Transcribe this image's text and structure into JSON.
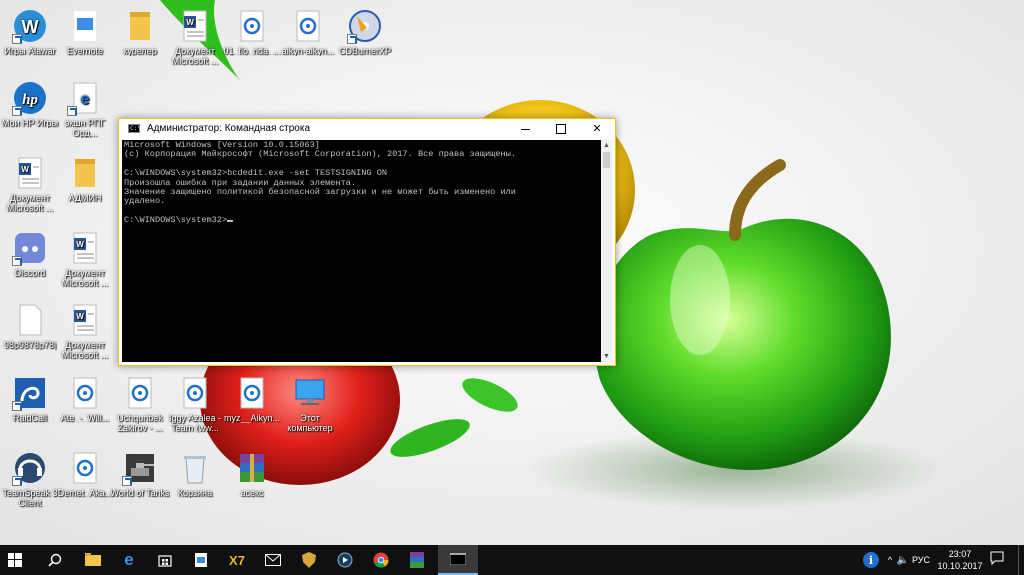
{
  "desktop": {
    "icons": [
      {
        "name": "igry-alawar-icon",
        "label": "Игры Alawar"
      },
      {
        "name": "evernote-icon",
        "label": "Evernote"
      },
      {
        "name": "kureler-folder-icon",
        "label": "курелер"
      },
      {
        "name": "word-doc-icon",
        "label": "Документ Microsoft ..."
      },
      {
        "name": "media-file-icon",
        "label": "01_flo_rida_..."
      },
      {
        "name": "media-file-icon",
        "label": "aikyn-aikyn..."
      },
      {
        "name": "cdburnerxp-icon",
        "label": "CDBurnerXP"
      },
      {
        "name": "hp-games-icon",
        "label": "Мои HP Игры"
      },
      {
        "name": "edge-shortcut-icon",
        "label": "экшн РПГ Орд..."
      },
      {
        "name": "word-doc-icon",
        "label": "Документ Microsoft ..."
      },
      {
        "name": "admin-folder-icon",
        "label": "АДМИН"
      },
      {
        "name": "discord-icon",
        "label": "Discord"
      },
      {
        "name": "word-doc-icon",
        "label": "Документ Microsoft ..."
      },
      {
        "name": "blank-file-icon",
        "label": "98p9878p78j"
      },
      {
        "name": "word-doc-icon",
        "label": "Документ Microsoft ..."
      },
      {
        "name": "raidcall-icon",
        "label": "RaidCall"
      },
      {
        "name": "media-file-icon",
        "label": "Ate_-_Will..."
      },
      {
        "name": "media-file-icon",
        "label": "Uchqunbek Zakirov - ..."
      },
      {
        "name": "media-file-icon",
        "label": "Iggy Azalea - Team (ww..."
      },
      {
        "name": "media-file-icon",
        "label": "myz__Aikyn..."
      },
      {
        "name": "this-pc-icon",
        "label": "Этот компьютер"
      },
      {
        "name": "teamspeak-icon",
        "label": "TeamSpeak 3 Client"
      },
      {
        "name": "media-file-icon",
        "label": "Demet_Aka..."
      },
      {
        "name": "world-of-tanks-icon",
        "label": "World of Tanks"
      },
      {
        "name": "recycle-bin-icon",
        "label": "Корзина"
      },
      {
        "name": "winrar-archive-icon",
        "label": "асекс"
      }
    ]
  },
  "cmd": {
    "title": "Администратор: Командная строка",
    "min_label": "",
    "max_label": "",
    "close_label": "✕",
    "lines": [
      "Microsoft Windows [Version 10.0.15063]",
      "(c) Корпорация Майкрософт (Microsoft Corporation), 2017. Все права защищены.",
      "",
      "C:\\WINDOWS\\system32>bcdedit.exe -set TESTSIGNING ON",
      "Произошла ошибка при задании данных элемента.",
      "Значение защищено политикой безопасной загрузки и не может быть изменено или",
      "удалено.",
      ""
    ],
    "prompt": "C:\\WINDOWS\\system32>"
  },
  "taskbar": {
    "language": "РУС",
    "time": "23:07",
    "date": "10.10.2017"
  },
  "colors": {
    "taskbar": "#101010",
    "cmd_border": "#f0c419",
    "cmd_text": "#c0c0c0",
    "accent": "#76b9ed"
  }
}
